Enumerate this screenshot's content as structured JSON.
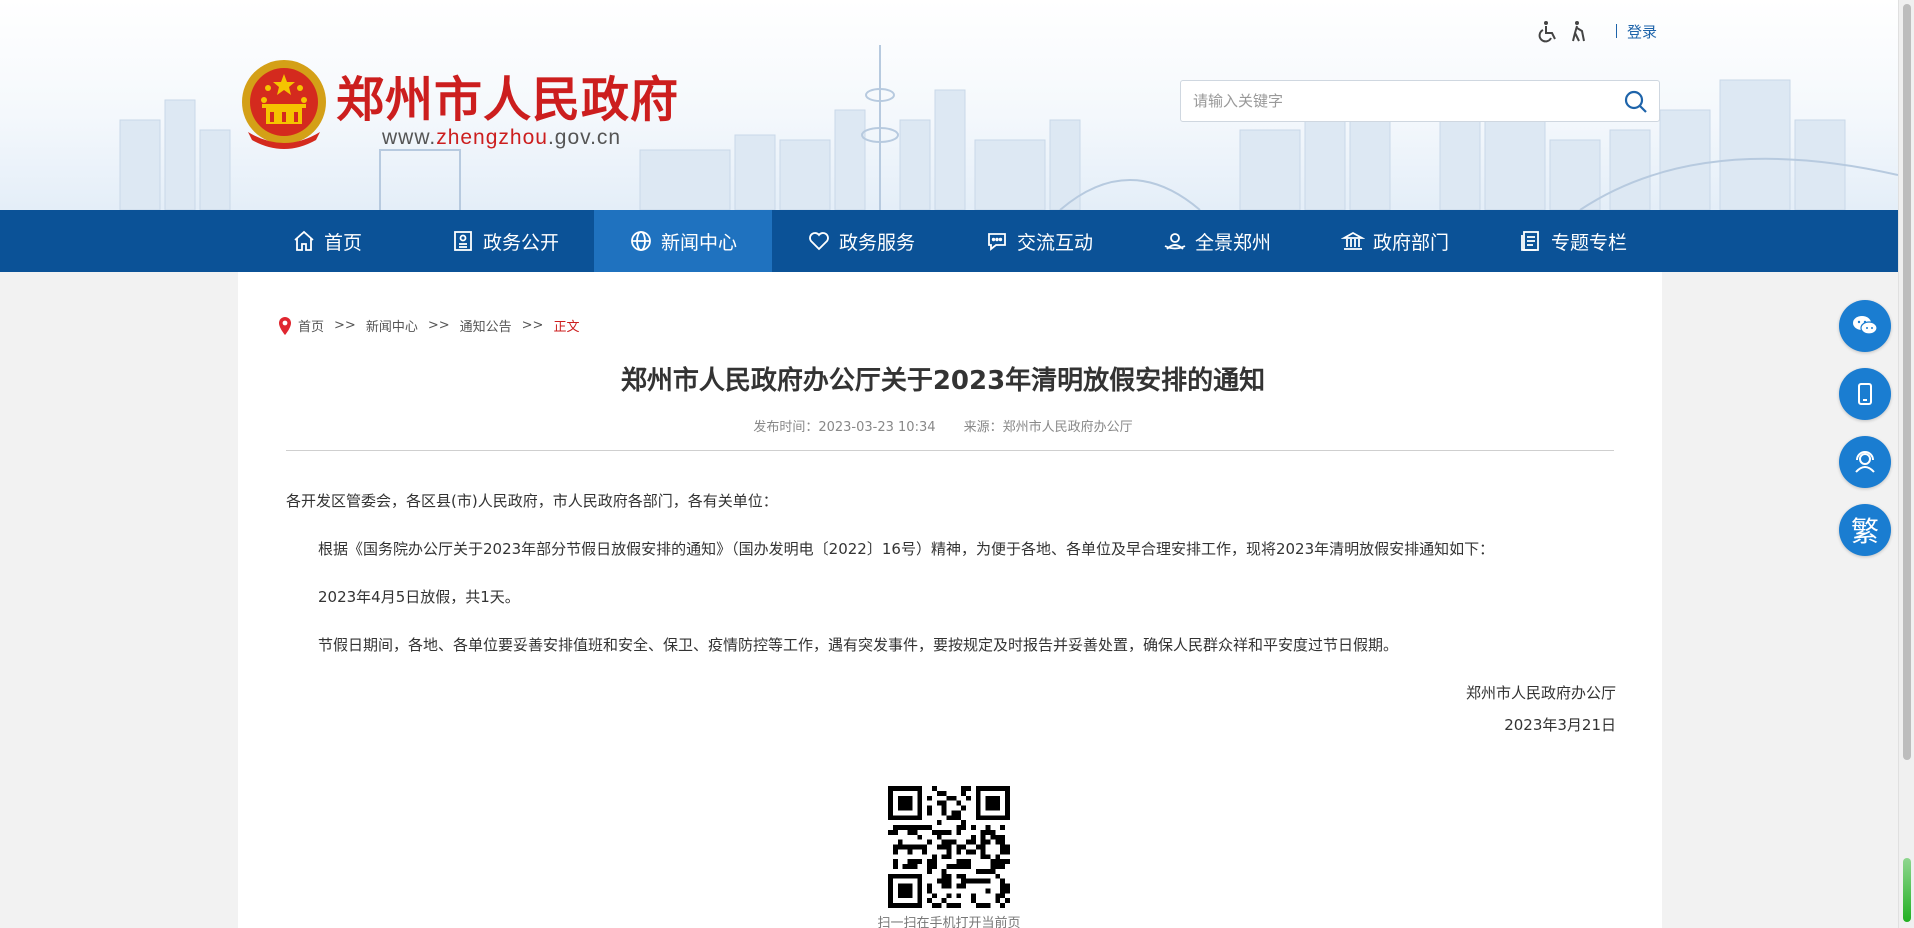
{
  "header": {
    "site_title": "郑州市人民政府",
    "url_prefix": "www.",
    "url_domain": "zhengzhou",
    "url_suffix": ".gov.cn",
    "accessibility_icons": [
      "wheelchair-icon",
      "elderly-icon"
    ],
    "login_label": "登录",
    "search_placeholder": "请输入关键字"
  },
  "nav": {
    "items": [
      {
        "label": "首页",
        "icon": "home-icon"
      },
      {
        "label": "政务公开",
        "icon": "id-card-icon"
      },
      {
        "label": "新闻中心",
        "icon": "globe-icon",
        "active": true
      },
      {
        "label": "政务服务",
        "icon": "heart-icon"
      },
      {
        "label": "交流互动",
        "icon": "chat-icon"
      },
      {
        "label": "全景郑州",
        "icon": "panorama-icon"
      },
      {
        "label": "政府部门",
        "icon": "building-icon"
      },
      {
        "label": "专题专栏",
        "icon": "document-icon"
      }
    ]
  },
  "breadcrumb": {
    "items": [
      "首页",
      "新闻中心",
      "通知公告"
    ],
    "separator": ">>",
    "current": "正文"
  },
  "article": {
    "title": "郑州市人民政府办公厅关于2023年清明放假安排的通知",
    "publish_time_label": "发布时间：2023-03-23 10:34",
    "source_label": "来源：郑州市人民政府办公厅",
    "salutation": "各开发区管委会，各区县(市)人民政府，市人民政府各部门，各有关单位：",
    "paragraphs": [
      "根据《国务院办公厅关于2023年部分节假日放假安排的通知》（国办发明电〔2022〕16号）精神，为便于各地、各单位及早合理安排工作，现将2023年清明放假安排通知如下：",
      "2023年4月5日放假，共1天。",
      "节假日期间，各地、各单位要妥善安排值班和安全、保卫、疫情防控等工作，遇有突发事件，要按规定及时报告并妥善处置，确保人民群众祥和平安度过节日假期。"
    ],
    "signature": "郑州市人民政府办公厅",
    "date": "2023年3月21日",
    "qr_caption": "扫一扫在手机打开当前页"
  },
  "floating_buttons": [
    {
      "name": "wechat-icon"
    },
    {
      "name": "mobile-icon"
    },
    {
      "name": "customer-service-icon"
    },
    {
      "name": "traditional-chinese",
      "label": "繁"
    }
  ],
  "colors": {
    "nav_bg": "#0b5297",
    "nav_active": "#1f72bf",
    "brand_red": "#cc1e1e",
    "float_btn": "#1a7dd1"
  }
}
